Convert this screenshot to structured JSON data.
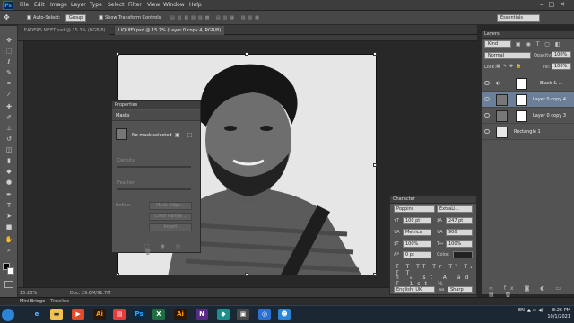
{
  "app": {
    "logo": "Ps"
  },
  "menu": [
    "File",
    "Edit",
    "Image",
    "Layer",
    "Type",
    "Select",
    "Filter",
    "View",
    "Window",
    "Help"
  ],
  "window_controls": {
    "minimize": "–",
    "maximize": "□",
    "close": "✕"
  },
  "options_bar": {
    "auto_select_label": "Auto-Select:",
    "auto_select_value": "Group",
    "show_transform_label": "Show Transform Controls",
    "workspace": "Essentials"
  },
  "doc_tabs": [
    {
      "label": "LEADERS MEET.psd @ 15.3% (RGB/8)",
      "active": false
    },
    {
      "label": "LIQUIFY.psd @ 15.7% (Layer 0 copy 4, RGB/8)",
      "active": true
    }
  ],
  "tools": [
    "move-icon",
    "marquee-icon",
    "lasso-icon",
    "quick-select-icon",
    "crop-icon",
    "eyedropper-icon",
    "healing-icon",
    "brush-icon",
    "stamp-icon",
    "history-brush-icon",
    "eraser-icon",
    "gradient-icon",
    "blur-icon",
    "dodge-icon",
    "pen-icon",
    "type-icon",
    "path-select-icon",
    "shape-icon",
    "hand-icon",
    "zoom-icon"
  ],
  "status": {
    "zoom": "15.28%",
    "doc": "Doc: 29.8M/91.7M"
  },
  "mini_bridge": {
    "tab1": "Mini Bridge",
    "tab2": "Timeline"
  },
  "layers_panel": {
    "title": "Layers",
    "kind": "Kind",
    "blend": "Normal",
    "opacity_label": "Opacity:",
    "opacity": "100%",
    "lock_label": "Lock:",
    "fill_label": "Fill:",
    "fill": "100%",
    "layers": [
      {
        "name": "Black & ...",
        "selected": false
      },
      {
        "name": "Layer 0 copy 4",
        "selected": true
      },
      {
        "name": "Layer 0 copy 3",
        "selected": false
      },
      {
        "name": "Rectangle 1",
        "selected": false
      }
    ]
  },
  "properties_panel": {
    "title": "Properties",
    "section": "Masks",
    "no_mask": "No mask selected",
    "density_label": "Density:",
    "feather_label": "Feather:",
    "refine_label": "Refine:",
    "mask_edge": "Mask Edge...",
    "color_range": "Color Range...",
    "invert": "Invert"
  },
  "character_panel": {
    "title": "Character",
    "font_family": "Poppins",
    "font_style": "ExtraLi...",
    "size": "100 pt",
    "leading": "247 pt",
    "kerning": "Metrics",
    "tracking": "900",
    "vscale": "100%",
    "hscale": "100%",
    "baseline": "0 pt",
    "color_label": "Color:",
    "language": "English: UK",
    "aa_label": "aa",
    "antialias": "Sharp"
  },
  "taskbar": {
    "lang": "EN",
    "time": "8:26 PM",
    "date": "10/1/2021"
  },
  "colors": {
    "accent": "#6b7f98",
    "ps_blue": "#2ea6ff",
    "taskbar": "#1b2733"
  }
}
